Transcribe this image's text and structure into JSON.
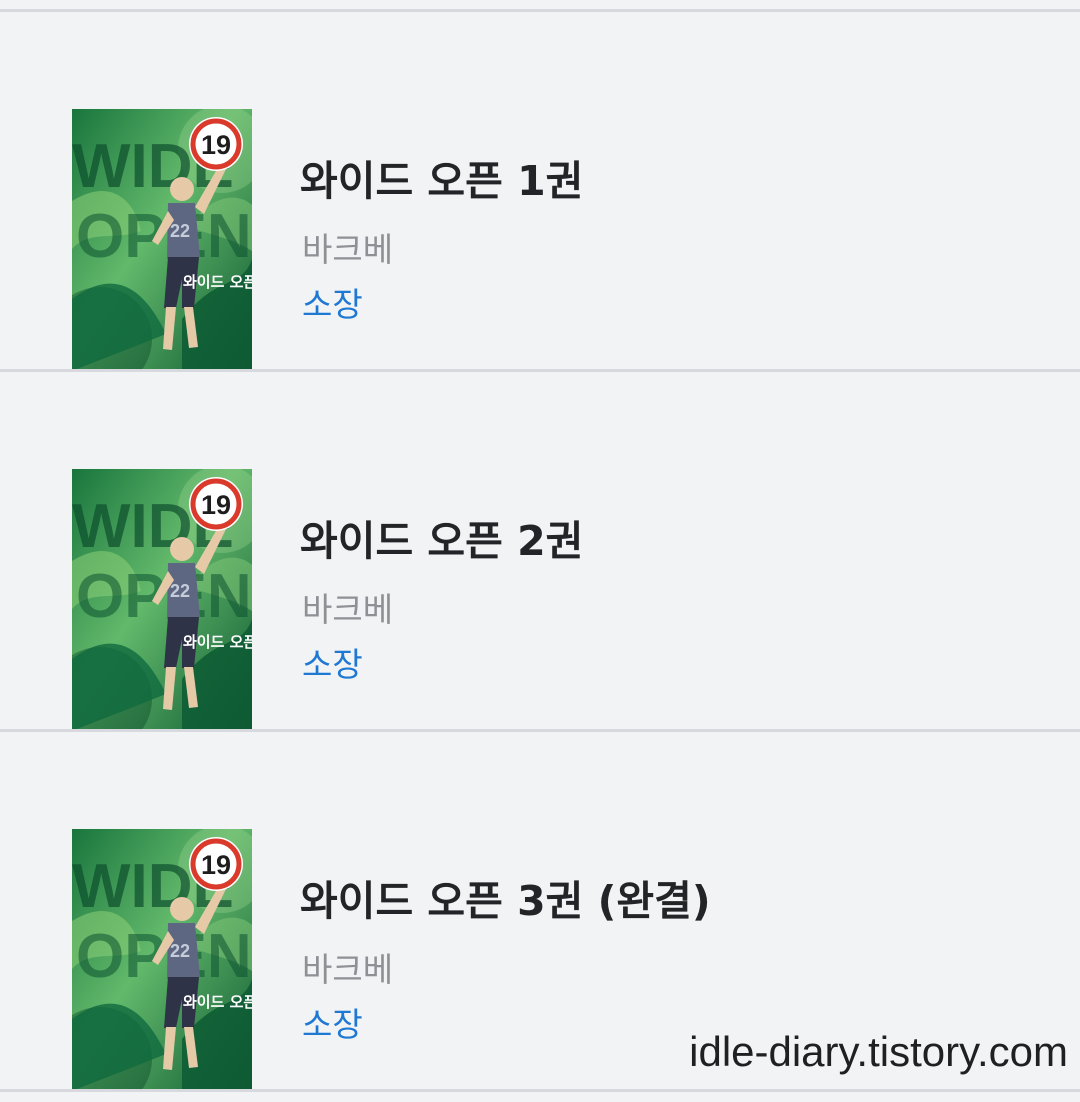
{
  "books": [
    {
      "title": "와이드 오픈 1권",
      "author": "바크베",
      "status": "소장",
      "age_rating": "19",
      "cover": {
        "logo_text": "WIDE OPEN",
        "korean_logo": "와이드 오픈",
        "jersey_number": "22"
      }
    },
    {
      "title": "와이드 오픈 2권",
      "author": "바크베",
      "status": "소장",
      "age_rating": "19",
      "cover": {
        "logo_text": "WIDE OPEN",
        "korean_logo": "와이드 오픈",
        "jersey_number": "22"
      }
    },
    {
      "title": "와이드 오픈 3권 (완결)",
      "author": "바크베",
      "status": "소장",
      "age_rating": "19",
      "cover": {
        "logo_text": "WIDE OPEN",
        "korean_logo": "와이드 오픈",
        "jersey_number": "22"
      }
    }
  ],
  "watermark": "idle-diary.tistory.com",
  "colors": {
    "background": "#f2f3f5",
    "divider": "#d7d9de",
    "title": "#222427",
    "author": "#8e9096",
    "status": "#1f78d1",
    "age_badge_ring": "#d93a2b"
  }
}
